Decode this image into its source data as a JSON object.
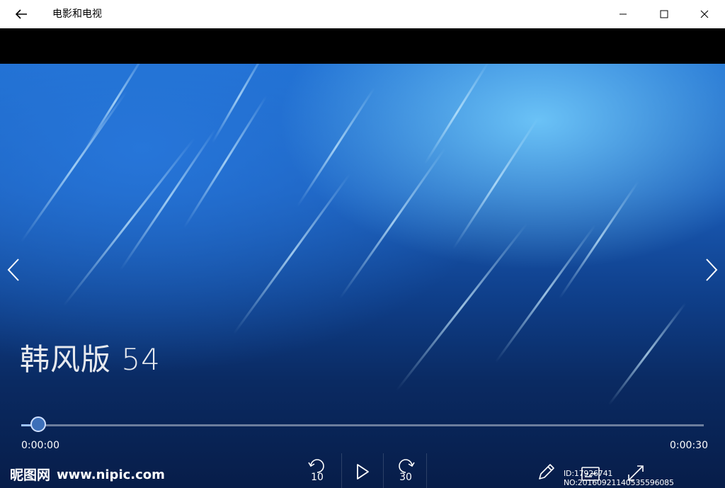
{
  "app": {
    "title": "电影和电视"
  },
  "media": {
    "title": "韩风版 54"
  },
  "playback": {
    "current_time": "0:00:00",
    "total_time": "0:00:30",
    "progress": 0.0,
    "skip_back_seconds": "10",
    "skip_forward_seconds": "30"
  },
  "watermark": {
    "logo_text": "昵图网",
    "url_text": "www.nipic.com",
    "id_text": "ID:17926741 NO:20160921140535596085"
  },
  "colors": {
    "titlebar_bg": "#ffffff",
    "seek_fill": "#9ec3ff",
    "video_dominant": "#1a5cb8"
  },
  "icons": {
    "back": "arrow-left-icon",
    "minimize": "minimize-icon",
    "maximize": "maximize-icon",
    "close": "close-icon",
    "prev": "chevron-left-icon",
    "next": "chevron-right-icon",
    "rewind": "skip-back-icon",
    "play": "play-icon",
    "forward": "skip-forward-icon",
    "pen": "pen-icon",
    "captions": "captions-icon",
    "fullscreen": "fullscreen-icon"
  }
}
